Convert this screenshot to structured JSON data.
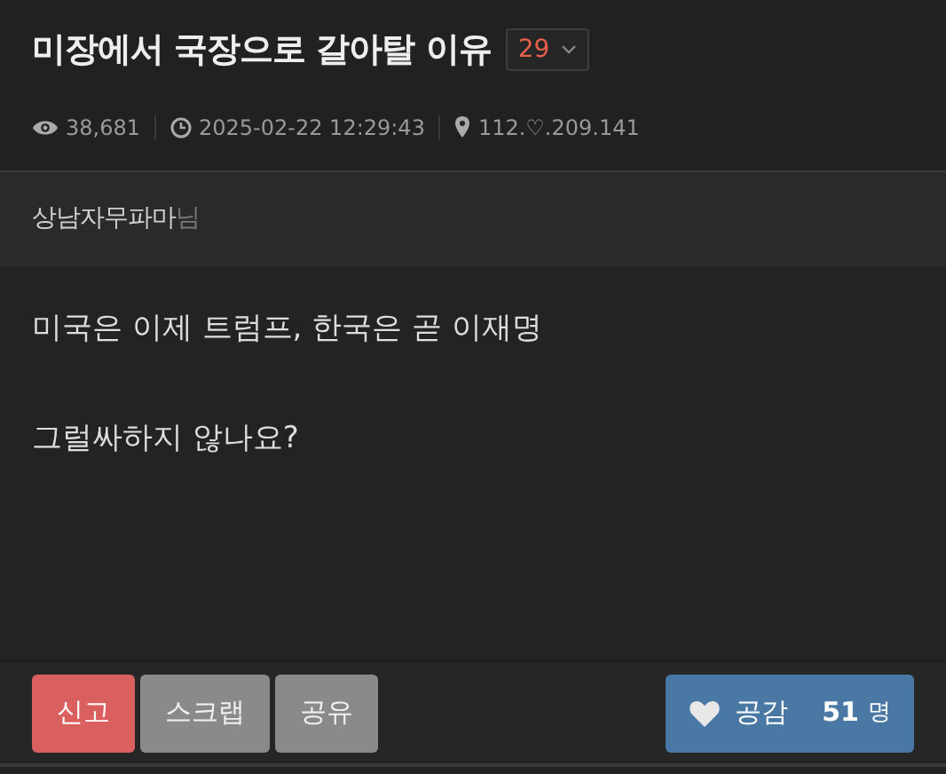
{
  "post": {
    "title": "미장에서 국장으로 갈아탈 이유",
    "comment_count": "29",
    "meta": [
      {
        "kind": "views",
        "text": "38,681"
      },
      {
        "kind": "time",
        "text": "2025-02-22 12:29:43"
      },
      {
        "kind": "ip",
        "text": "112.♡.209.141"
      }
    ],
    "author": {
      "name": "상남자무파마",
      "suffix": "님"
    },
    "body": [
      "미국은 이제 트럼프, 한국은 곧 이재명",
      "그럴싸하지 않나요?"
    ]
  },
  "actions": [
    {
      "kind": "danger",
      "label": "신고"
    },
    {
      "kind": "gray",
      "label": "스크랩"
    },
    {
      "kind": "gray",
      "label": "공유"
    }
  ],
  "like": {
    "label": "공감",
    "count": "51",
    "unit": "명"
  }
}
